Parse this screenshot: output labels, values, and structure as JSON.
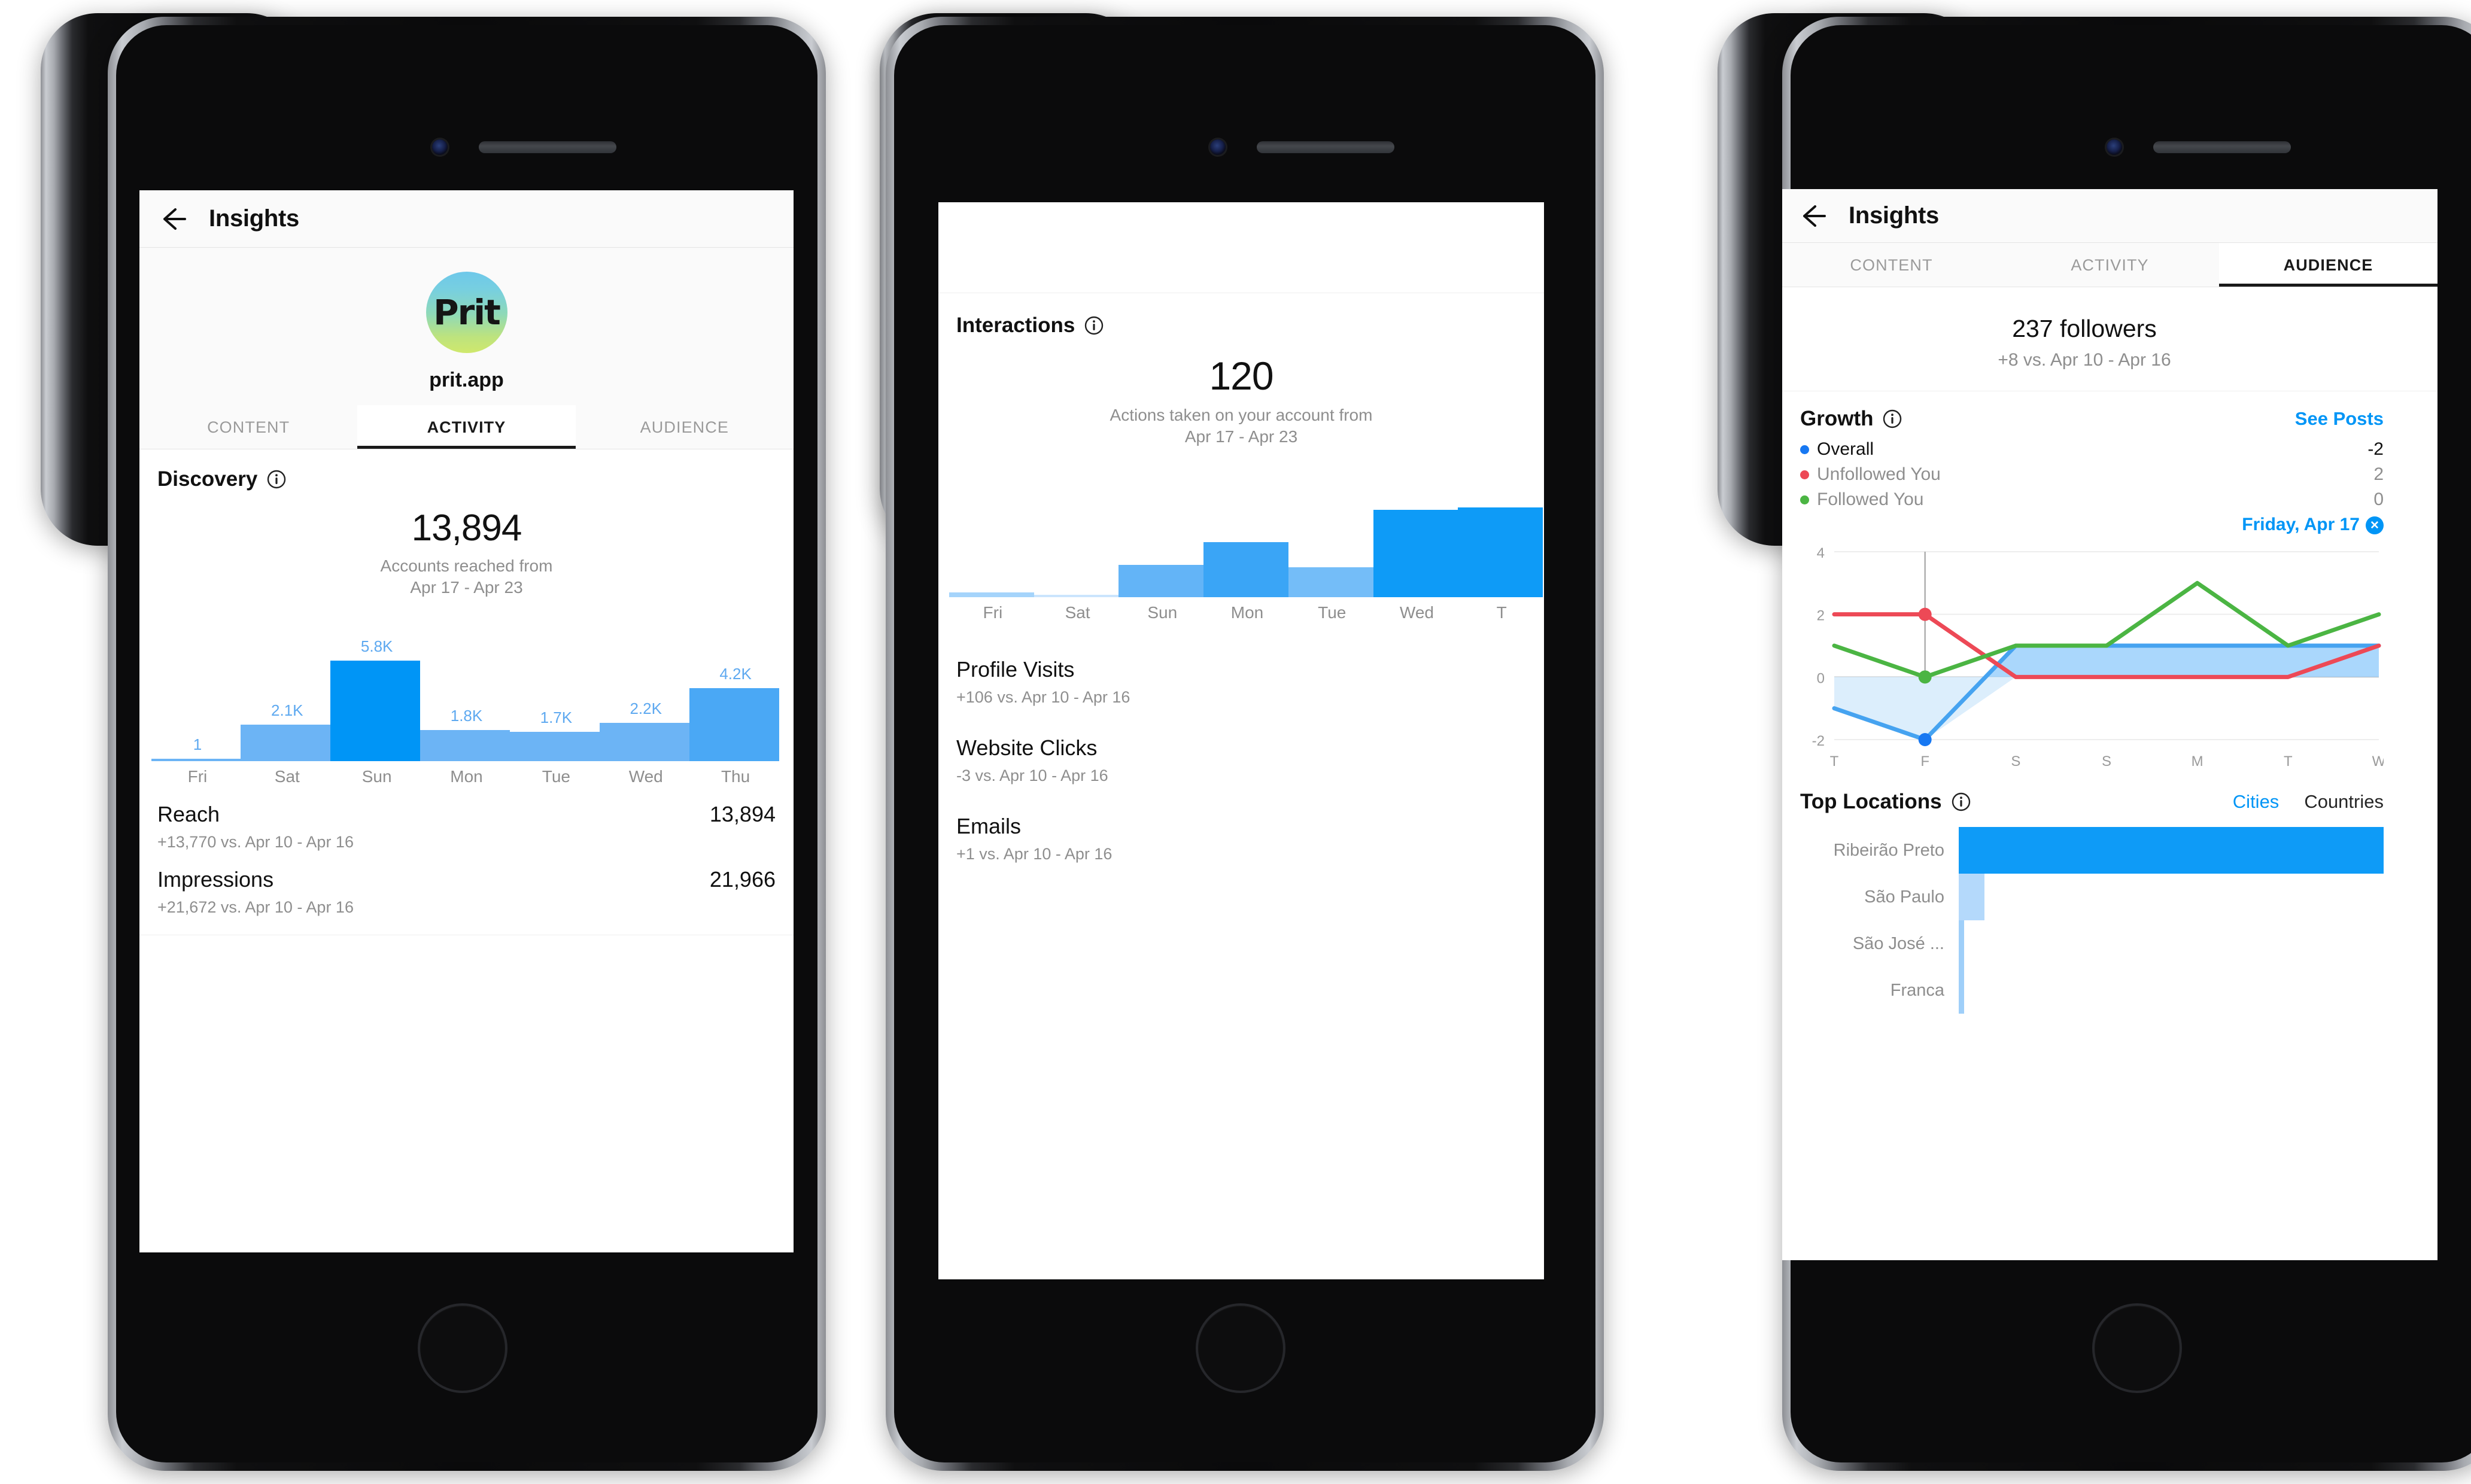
{
  "phones": {
    "phone1": {
      "nav": {
        "title": "Insights",
        "back_icon": "back-arrow-icon"
      },
      "profile": {
        "avatar_text": "Prit",
        "username": "prit.app"
      },
      "tabs": [
        {
          "label": "CONTENT",
          "active": false
        },
        {
          "label": "ACTIVITY",
          "active": true
        },
        {
          "label": "AUDIENCE",
          "active": false
        }
      ],
      "discovery": {
        "title": "Discovery",
        "info_icon": "info-icon",
        "value": "13,894",
        "caption_line1": "Accounts reached from",
        "caption_line2": "Apr 17 - Apr 23"
      },
      "rows": [
        {
          "name": "Reach",
          "value": "13,894",
          "sub": "+13,770 vs. Apr 10 - Apr 16"
        },
        {
          "name": "Impressions",
          "value": "21,966",
          "sub": "+21,672 vs. Apr 10 - Apr 16"
        }
      ]
    },
    "phone2": {
      "interactions": {
        "title": "Interactions",
        "info_icon": "info-icon",
        "value": "120",
        "caption_line1": "Actions taken on your account from",
        "caption_line2": "Apr 17 - Apr 23"
      },
      "rows": [
        {
          "name": "Profile Visits",
          "sub": "+106 vs. Apr 10 - Apr 16"
        },
        {
          "name": "Website Clicks",
          "sub": "-3 vs. Apr 10 - Apr 16"
        },
        {
          "name": "Emails",
          "sub": "+1 vs. Apr 10 - Apr 16"
        }
      ]
    },
    "phone3": {
      "nav": {
        "title": "Insights",
        "back_icon": "back-arrow-icon"
      },
      "tabs": [
        {
          "label": "CONTENT",
          "active": false
        },
        {
          "label": "ACTIVITY",
          "active": false
        },
        {
          "label": "AUDIENCE",
          "active": true
        }
      ],
      "followers": {
        "count": "237 followers",
        "sub": "+8 vs. Apr 10 - Apr 16"
      },
      "growth": {
        "title": "Growth",
        "info_icon": "info-icon",
        "see_posts": "See Posts",
        "legend": [
          {
            "label": "Overall",
            "value": "-2",
            "color": "#1778f2",
            "active": true
          },
          {
            "label": "Unfollowed You",
            "value": "2",
            "color": "#ed4956",
            "active": false
          },
          {
            "label": "Followed You",
            "value": "0",
            "color": "#4bb543",
            "active": false
          }
        ],
        "selected_day": "Friday, Apr 17",
        "close_icon": "close-circle-icon"
      },
      "locations": {
        "title": "Top Locations",
        "info_icon": "info-icon",
        "toggle": [
          {
            "label": "Cities",
            "active": true
          },
          {
            "label": "Countries",
            "active": false
          }
        ]
      }
    }
  },
  "chart_data": [
    {
      "id": "discovery-bar-chart",
      "type": "bar",
      "title": "Discovery",
      "subtitle": "Accounts reached from Apr 17 - Apr 23",
      "categories": [
        "Fri",
        "Sat",
        "Sun",
        "Mon",
        "Tue",
        "Wed",
        "Thu"
      ],
      "values": [
        1,
        2100,
        5800,
        1800,
        1700,
        2200,
        4200
      ],
      "value_labels": [
        "1",
        "2.1K",
        "5.8K",
        "1.8K",
        "1.7K",
        "2.2K",
        "4.2K"
      ],
      "bar_colors": [
        "#6cb4f5",
        "#6cb4f5",
        "#0095f6",
        "#6cb4f5",
        "#6cb4f5",
        "#6cb4f5",
        "#4aa8f5"
      ],
      "xlabel": "",
      "ylabel": "",
      "ylim": [
        0,
        5800
      ],
      "grid": false,
      "legend": "none",
      "total": 13894
    },
    {
      "id": "interactions-bar-chart",
      "type": "bar",
      "title": "Interactions",
      "subtitle": "Actions taken on your account from Apr 17 - Apr 23",
      "categories": [
        "Fri",
        "Sat",
        "Sun",
        "Mon",
        "Tue",
        "Wed",
        "T"
      ],
      "values": [
        2,
        1,
        13,
        22,
        12,
        35,
        36
      ],
      "bar_colors": [
        "#a5d4fb",
        "#cbe5fd",
        "#63b4f7",
        "#3aa5f6",
        "#74bdf8",
        "#0e9bf7",
        "#0e9bf7"
      ],
      "xlabel": "",
      "ylabel": "",
      "ylim": [
        0,
        36
      ],
      "grid": false,
      "legend": "none",
      "total": 120,
      "note": "rightmost bar clipped by screen edge"
    },
    {
      "id": "growth-line-chart",
      "type": "line",
      "title": "Growth",
      "x": [
        "T",
        "F",
        "S",
        "S",
        "M",
        "T",
        "W"
      ],
      "ylim": [
        -2,
        4
      ],
      "yticks": [
        -2,
        0,
        2,
        4
      ],
      "grid": true,
      "legend": "top",
      "selected_x": "F",
      "series": [
        {
          "name": "Overall",
          "color": "#1778f2",
          "values": [
            -1,
            -2,
            1,
            1,
            1,
            1,
            1
          ],
          "area": true
        },
        {
          "name": "Unfollowed You",
          "color": "#ed4956",
          "values": [
            2,
            2,
            0,
            0,
            0,
            0,
            1
          ]
        },
        {
          "name": "Followed You",
          "color": "#4bb543",
          "values": [
            1,
            0,
            1,
            1,
            3,
            1,
            2
          ]
        }
      ]
    },
    {
      "id": "top-locations-bar-chart",
      "type": "bar",
      "orientation": "horizontal",
      "title": "Top Locations",
      "categories": [
        "Ribeirão Preto",
        "São Paulo",
        "São José ...",
        "Franca"
      ],
      "values": [
        100,
        6,
        1.2,
        1.2
      ],
      "bar_colors": [
        "#0e9bf7",
        "#b4d9fb",
        "#9fcff9",
        "#9fcff9"
      ],
      "xlabel": "",
      "ylabel": "",
      "grid": false,
      "legend": "none"
    }
  ]
}
